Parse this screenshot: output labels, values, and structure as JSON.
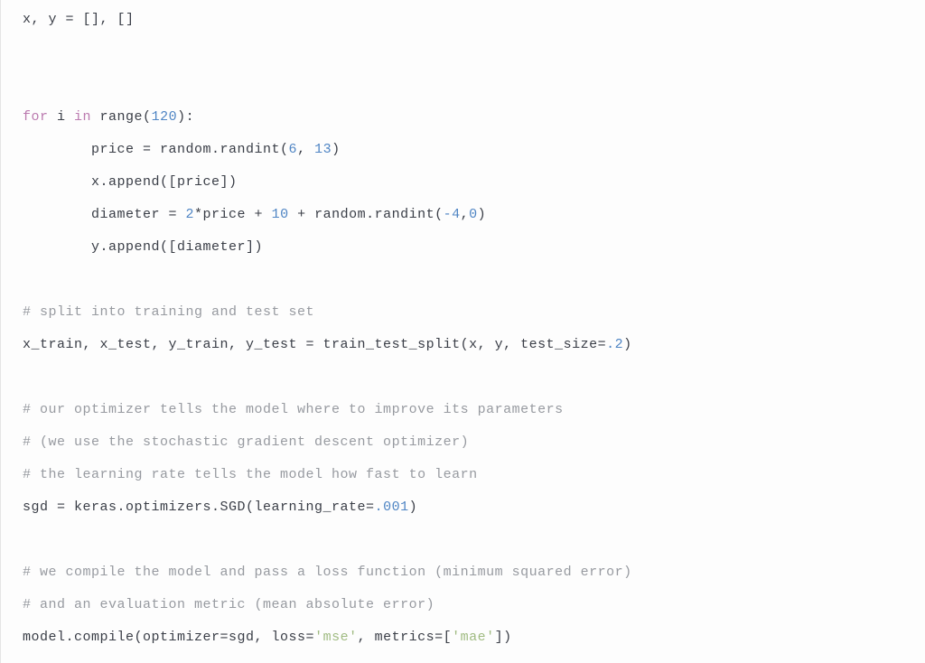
{
  "code": {
    "lines": [
      [
        {
          "cls": "t",
          "text": "x, y = [], []"
        }
      ],
      [
        {
          "cls": "t",
          "text": ""
        }
      ],
      [
        {
          "cls": "t",
          "text": ""
        }
      ],
      [
        {
          "cls": "k",
          "text": "for"
        },
        {
          "cls": "t",
          "text": " i "
        },
        {
          "cls": "k",
          "text": "in"
        },
        {
          "cls": "t",
          "text": " range("
        },
        {
          "cls": "n",
          "text": "120"
        },
        {
          "cls": "t",
          "text": "):"
        }
      ],
      [
        {
          "cls": "t",
          "text": "        price = random.randint("
        },
        {
          "cls": "n",
          "text": "6"
        },
        {
          "cls": "t",
          "text": ", "
        },
        {
          "cls": "n",
          "text": "13"
        },
        {
          "cls": "t",
          "text": ")"
        }
      ],
      [
        {
          "cls": "t",
          "text": "        x.append([price])"
        }
      ],
      [
        {
          "cls": "t",
          "text": "        diameter = "
        },
        {
          "cls": "n",
          "text": "2"
        },
        {
          "cls": "t",
          "text": "*price + "
        },
        {
          "cls": "n",
          "text": "10"
        },
        {
          "cls": "t",
          "text": " + random.randint("
        },
        {
          "cls": "n",
          "text": "-4"
        },
        {
          "cls": "t",
          "text": ","
        },
        {
          "cls": "n",
          "text": "0"
        },
        {
          "cls": "t",
          "text": ")"
        }
      ],
      [
        {
          "cls": "t",
          "text": "        y.append([diameter])"
        }
      ],
      [
        {
          "cls": "t",
          "text": ""
        }
      ],
      [
        {
          "cls": "c",
          "text": "# split into training and test set"
        }
      ],
      [
        {
          "cls": "t",
          "text": "x_train, x_test, y_train, y_test = train_test_split(x, y, test_size="
        },
        {
          "cls": "n",
          "text": ".2"
        },
        {
          "cls": "t",
          "text": ")"
        }
      ],
      [
        {
          "cls": "t",
          "text": ""
        }
      ],
      [
        {
          "cls": "c",
          "text": "# our optimizer tells the model where to improve its parameters"
        }
      ],
      [
        {
          "cls": "c",
          "text": "# (we use the stochastic gradient descent optimizer)"
        }
      ],
      [
        {
          "cls": "c",
          "text": "# the learning rate tells the model how fast to learn"
        }
      ],
      [
        {
          "cls": "t",
          "text": "sgd = keras.optimizers.SGD(learning_rate="
        },
        {
          "cls": "n",
          "text": ".001"
        },
        {
          "cls": "t",
          "text": ")"
        }
      ],
      [
        {
          "cls": "t",
          "text": ""
        }
      ],
      [
        {
          "cls": "c",
          "text": "# we compile the model and pass a loss function (minimum squared error)"
        }
      ],
      [
        {
          "cls": "c",
          "text": "# and an evaluation metric (mean absolute error)"
        }
      ],
      [
        {
          "cls": "t",
          "text": "model.compile(optimizer=sgd, loss="
        },
        {
          "cls": "s",
          "text": "'mse'"
        },
        {
          "cls": "t",
          "text": ", metrics=["
        },
        {
          "cls": "s",
          "text": "'mae'"
        },
        {
          "cls": "t",
          "text": "])"
        }
      ]
    ]
  }
}
